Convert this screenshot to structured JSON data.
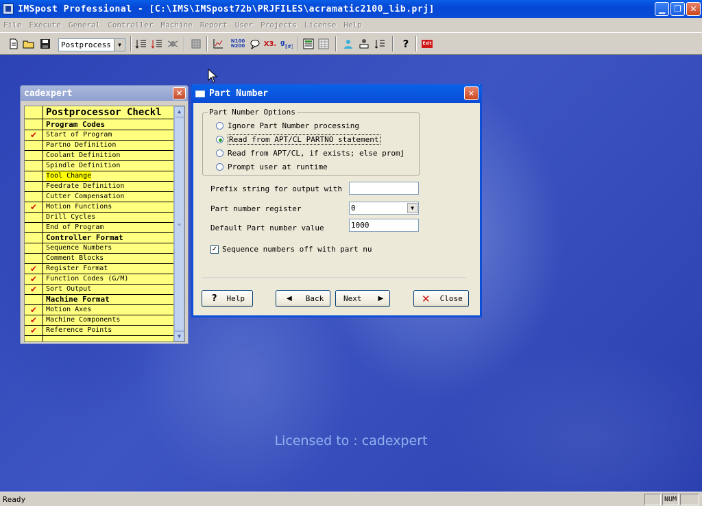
{
  "window": {
    "title": "IMSpost Professional - [C:\\IMS\\IMSpost72b\\PRJFILES\\acramatic2100_lib.prj]",
    "minimize": "▁",
    "restore": "❐",
    "close": "✕"
  },
  "menu": [
    "File",
    "Execute",
    "General",
    "Controller",
    "Machine",
    "Report",
    "User",
    "Projects",
    "License",
    "Help"
  ],
  "toolbar": {
    "mode_select": "Postprocess",
    "n100_label": "N100\nN200",
    "x3_label": "X3.",
    "exit_label": "Exit"
  },
  "checklist_window": {
    "title": "cadexpert",
    "close": "✕",
    "header": "Postprocessor Checkl",
    "rows": [
      {
        "label": "Program Codes",
        "section": true,
        "checked": false
      },
      {
        "label": "Start of Program",
        "section": false,
        "checked": true
      },
      {
        "label": "Partno Definition",
        "section": false,
        "checked": false
      },
      {
        "label": "Coolant Definition",
        "section": false,
        "checked": false
      },
      {
        "label": "Spindle Definition",
        "section": false,
        "checked": false
      },
      {
        "label": "Tool Change",
        "section": false,
        "checked": false,
        "highlight": true
      },
      {
        "label": "Feedrate Definition",
        "section": false,
        "checked": false
      },
      {
        "label": "Cutter Compensation",
        "section": false,
        "checked": false
      },
      {
        "label": "Motion Functions",
        "section": false,
        "checked": true
      },
      {
        "label": "Drill Cycles",
        "section": false,
        "checked": false
      },
      {
        "label": "End of Program",
        "section": false,
        "checked": false
      },
      {
        "label": "Controller Format",
        "section": true,
        "checked": false
      },
      {
        "label": "Sequence Numbers",
        "section": false,
        "checked": false
      },
      {
        "label": "Comment Blocks",
        "section": false,
        "checked": false
      },
      {
        "label": "Register Format",
        "section": false,
        "checked": true
      },
      {
        "label": "Function Codes (G/M)",
        "section": false,
        "checked": true
      },
      {
        "label": "Sort Output",
        "section": false,
        "checked": true
      },
      {
        "label": "Machine Format",
        "section": true,
        "checked": false
      },
      {
        "label": "Motion Axes",
        "section": false,
        "checked": true
      },
      {
        "label": "Machine Components",
        "section": false,
        "checked": true
      },
      {
        "label": "Reference Points",
        "section": false,
        "checked": true
      }
    ]
  },
  "dialog": {
    "title": "Part Number",
    "close": "✕",
    "group_label": "Part Number Options",
    "options": [
      {
        "label": "Ignore Part Number processing",
        "selected": false
      },
      {
        "label": "Read from APT/CL PARTNO statement",
        "selected": true
      },
      {
        "label": "Read from APT/CL, if exists; else promj",
        "selected": false
      },
      {
        "label": "Prompt user at runtime",
        "selected": false
      }
    ],
    "prefix_label": "Prefix string for output with",
    "prefix_value": "",
    "register_label": "Part number register",
    "register_value": "0",
    "default_label": "Default Part number value",
    "default_value": "1000",
    "seq_checkbox_label": "Sequence numbers off with part nu",
    "seq_checked": true,
    "buttons": {
      "help": "Help",
      "back": "Back",
      "next": "Next",
      "close": "Close"
    },
    "icons": {
      "help": "?",
      "back": "◀",
      "next": "▶",
      "close": "✕"
    }
  },
  "desktop": {
    "licensed": "Licensed to : cadexpert"
  },
  "status": {
    "ready": "Ready",
    "num": "NUM"
  },
  "colors": {
    "accent": "#0b4fd8",
    "checklist_bg": "#ffff80",
    "check_mark": "#d01010"
  }
}
